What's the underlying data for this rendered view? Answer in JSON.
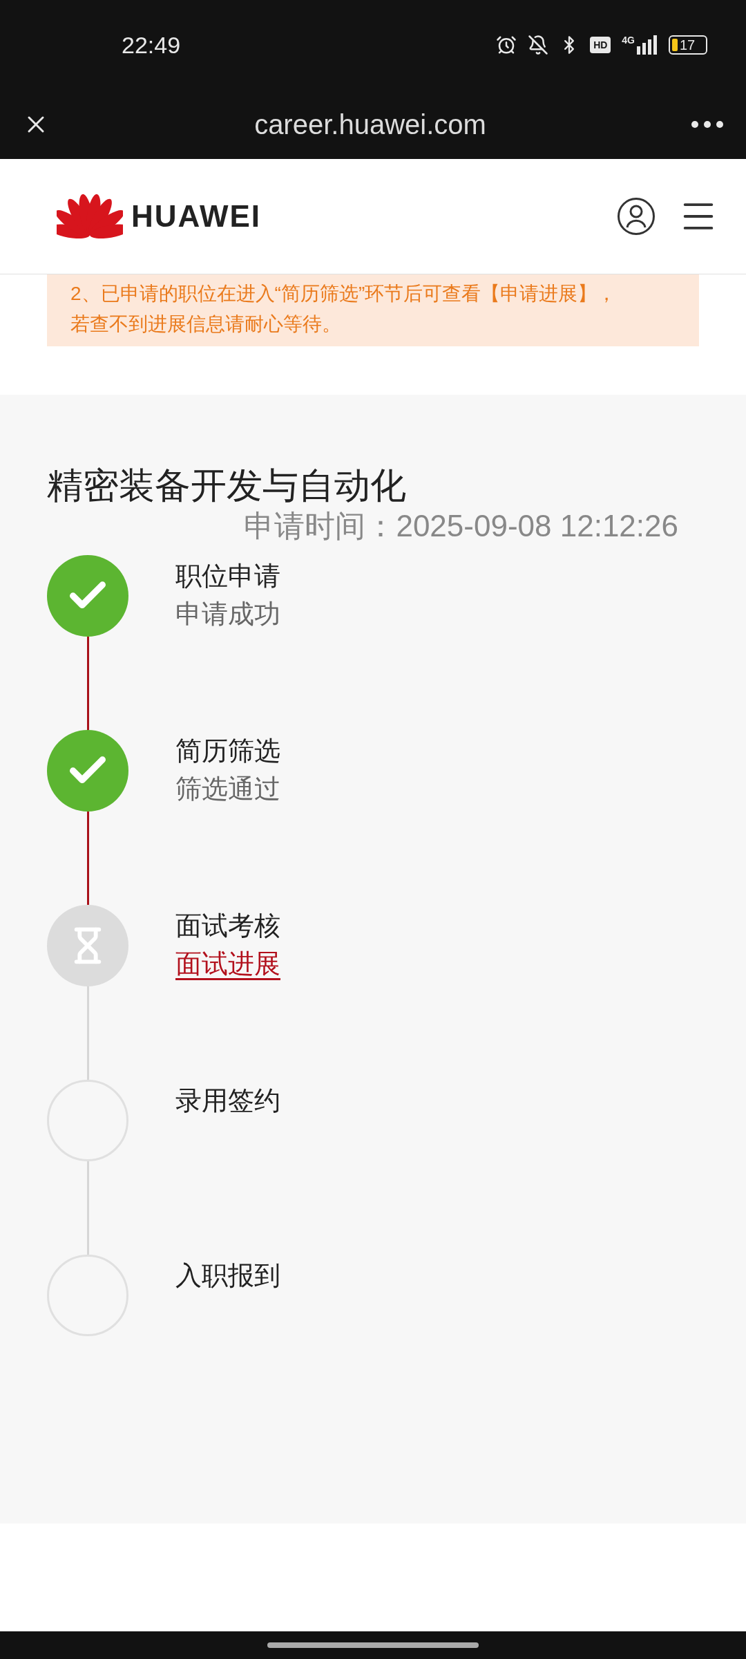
{
  "status_bar": {
    "time": "22:49",
    "hd": "HD",
    "network": "4G",
    "battery": "17"
  },
  "browser_bar": {
    "url": "career.huawei.com"
  },
  "header": {
    "brand": "HUAWEI"
  },
  "notice": {
    "lines": [
      "2、已申请的职位在进入“简历筛选”环节后可查看【申请进展】，",
      "若查不到进展信息请耐心等待。"
    ]
  },
  "application": {
    "position": "精密装备开发与自动化",
    "applied_time": "申请时间：2025-09-08 12:12:26",
    "steps": [
      {
        "title": "职位申请",
        "kind": "done",
        "detail": "申请成功"
      },
      {
        "title": "简历筛选",
        "kind": "done",
        "detail": "筛选通过"
      },
      {
        "title": "面试考核",
        "kind": "current",
        "link": "面试进展"
      },
      {
        "title": "录用签约",
        "kind": "todo"
      },
      {
        "title": "入职报到",
        "kind": "todo"
      }
    ]
  }
}
